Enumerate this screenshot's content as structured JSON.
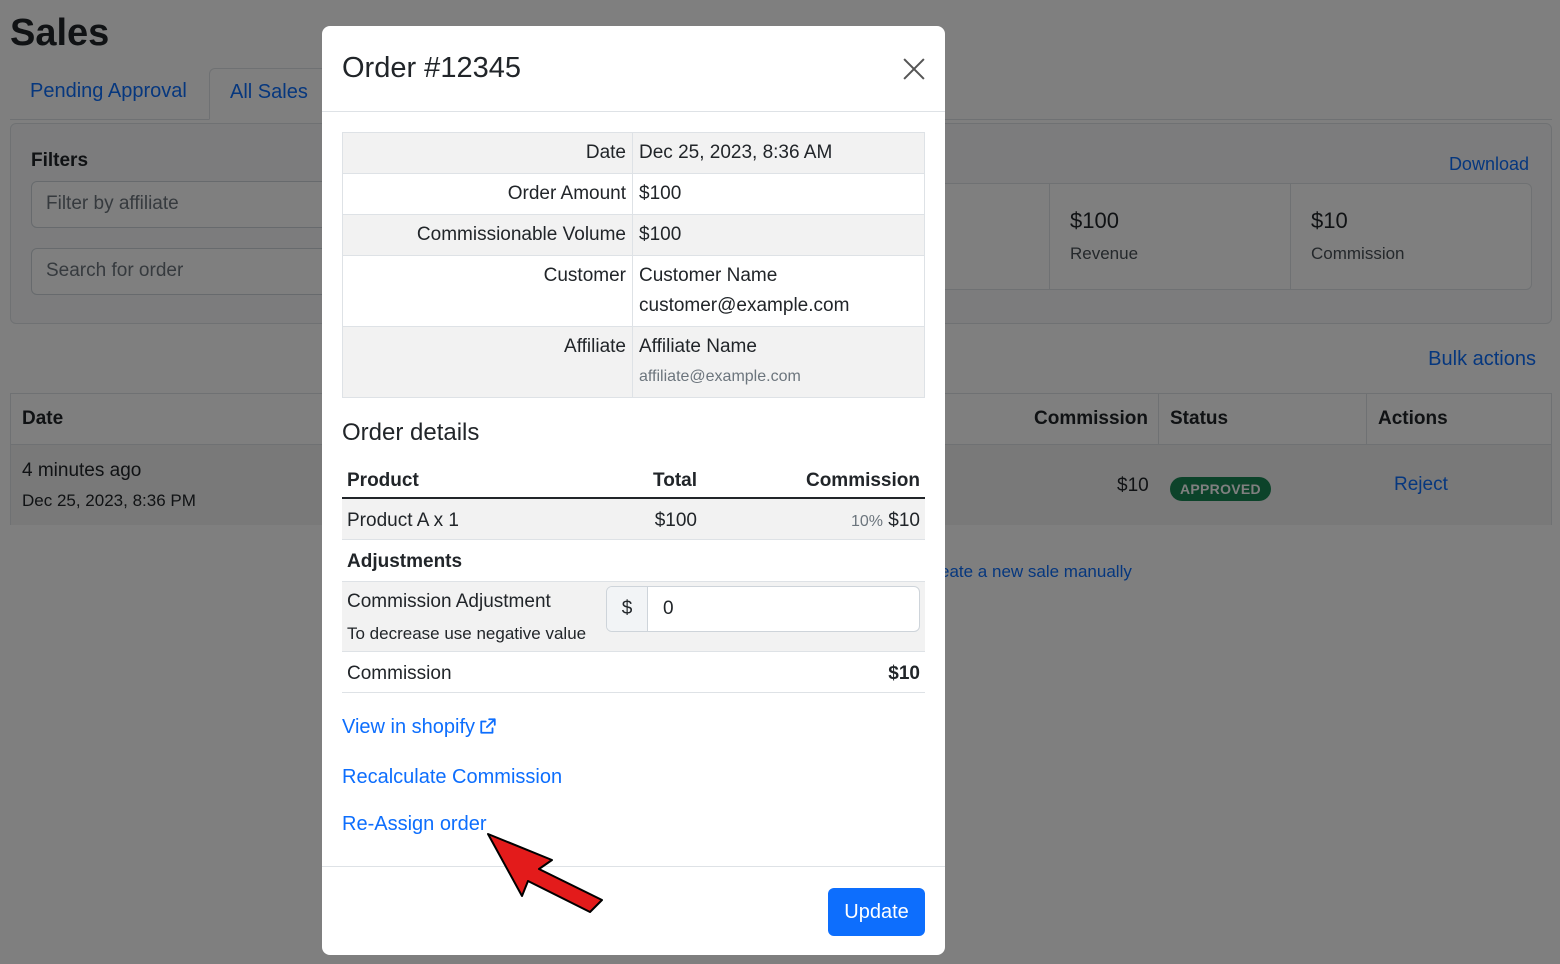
{
  "page": {
    "title": "Sales",
    "tabs": [
      "Pending Approval",
      "All Sales"
    ],
    "filters": {
      "title": "Filters",
      "affiliate_placeholder": "Filter by affiliate",
      "order_placeholder": "Search for order",
      "download_label": "Download"
    },
    "stats": [
      {
        "value": "$100",
        "label": "Revenue"
      },
      {
        "value": "$10",
        "label": "Commission"
      }
    ],
    "bulk_actions_label": "Bulk actions",
    "table": {
      "headers": {
        "date": "Date",
        "commission": "Commission",
        "status": "Status",
        "actions": "Actions"
      },
      "row": {
        "relative_date": "4 minutes ago",
        "date": "Dec 25, 2023, 8:36 PM",
        "commission": "$10",
        "status": "APPROVED",
        "action": "Reject"
      }
    },
    "manual_sale_label": "eate a new sale manually"
  },
  "modal": {
    "title": "Order #12345",
    "info": {
      "date_label": "Date",
      "date_value": "Dec 25, 2023, 8:36 AM",
      "amount_label": "Order Amount",
      "amount_value": "$100",
      "volume_label": "Commissionable Volume",
      "volume_value": "$100",
      "customer_label": "Customer",
      "customer_name": "Customer Name",
      "customer_email": "customer@example.com",
      "affiliate_label": "Affiliate",
      "affiliate_name": "Affiliate Name",
      "affiliate_email": "affiliate@example.com"
    },
    "details": {
      "title": "Order details",
      "headers": {
        "product": "Product",
        "total": "Total",
        "commission": "Commission"
      },
      "product": {
        "name": "Product A x 1",
        "total": "$100",
        "rate": "10%",
        "commission": "$10"
      },
      "adjustments_title": "Adjustments",
      "adjustment_label": "Commission Adjustment",
      "adjustment_hint": "To decrease use negative value",
      "currency_symbol": "$",
      "adjustment_value": "0",
      "commission_label": "Commission",
      "commission_total": "$10"
    },
    "links": {
      "shopify": "View in shopify",
      "recalculate": "Recalculate Commission",
      "reassign": "Re-Assign order"
    },
    "update_label": "Update"
  },
  "colors": {
    "accent": "#0d6efd",
    "success": "#198754",
    "arrow": "#e31b1b"
  },
  "icons": [
    "close-icon",
    "external-link-icon",
    "red-arrow"
  ]
}
